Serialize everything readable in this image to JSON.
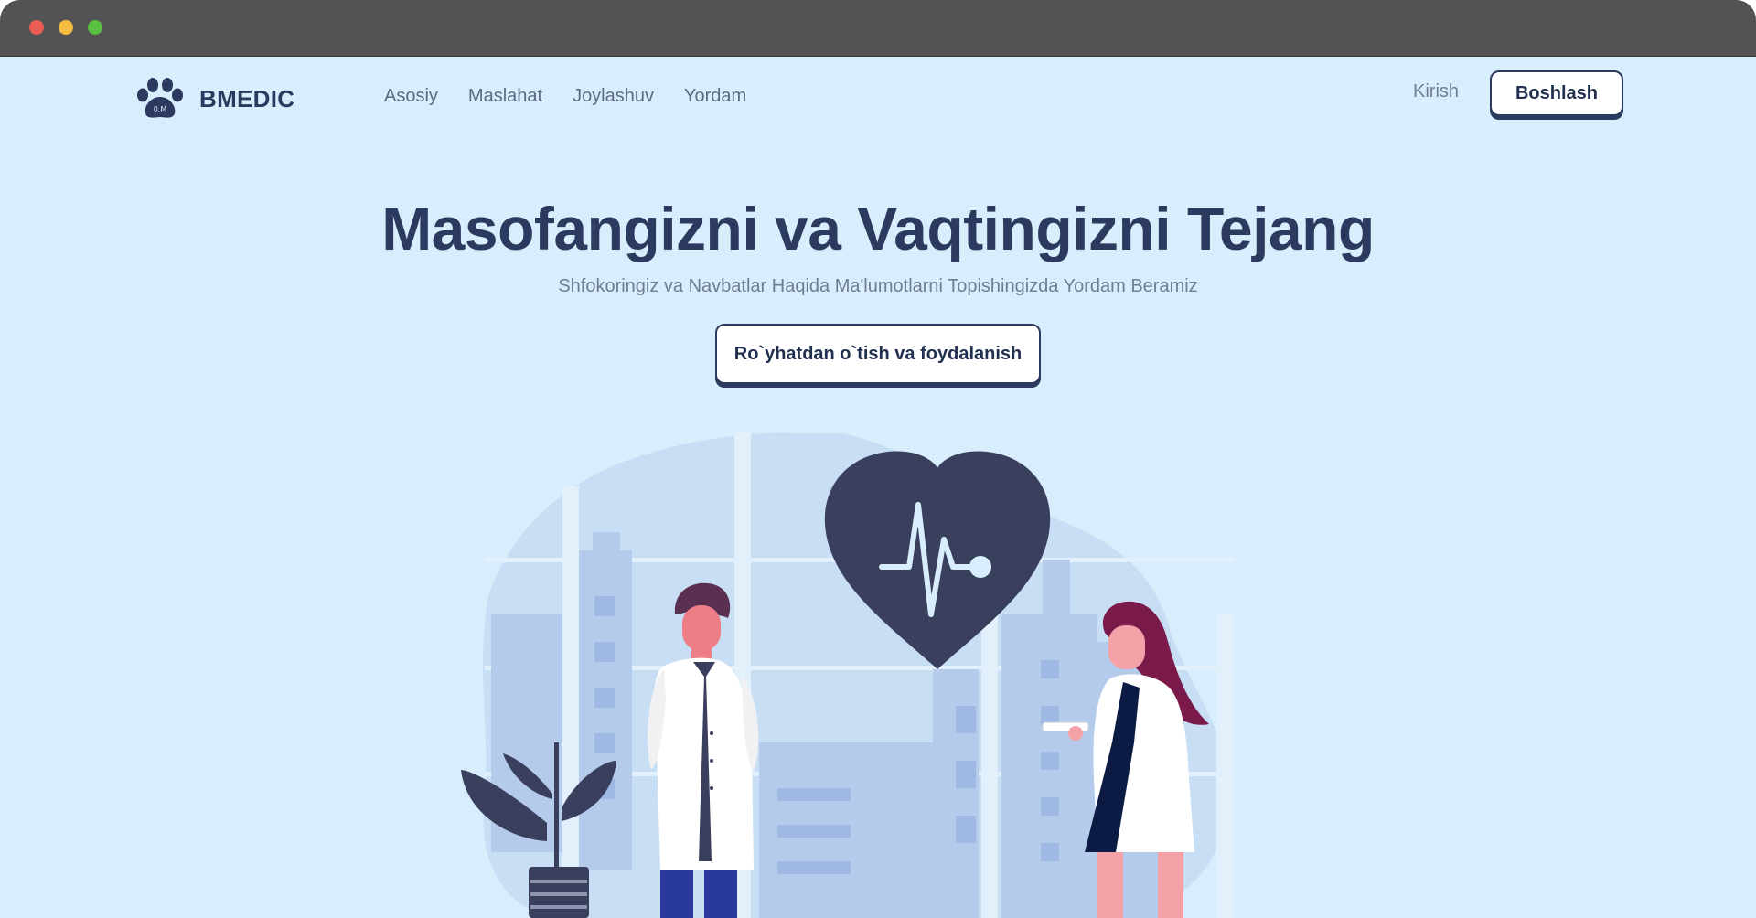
{
  "brand": {
    "name": "BMEDIC",
    "logo_icon": "paw-icon"
  },
  "nav": {
    "links": [
      "Asosiy",
      "Maslahat",
      "Joylashuv",
      "Yordam"
    ],
    "login_label": "Kirish",
    "start_label": "Boshlash"
  },
  "hero": {
    "title": "Masofangizni va Vaqtingizni Tejang",
    "subtitle": "Shfokoringiz va Navbatlar Haqida Ma'lumotlarni Topishingizda Yordam Beramiz",
    "cta_label": "Ro`yhatdan o`tish va foydalanish"
  },
  "illustration": {
    "icon": "doctors-heart-illustration"
  },
  "colors": {
    "background": "#d8eefc",
    "primary": "#2b3a5e",
    "muted_text": "#6f7c95",
    "titlebar": "#535353"
  }
}
